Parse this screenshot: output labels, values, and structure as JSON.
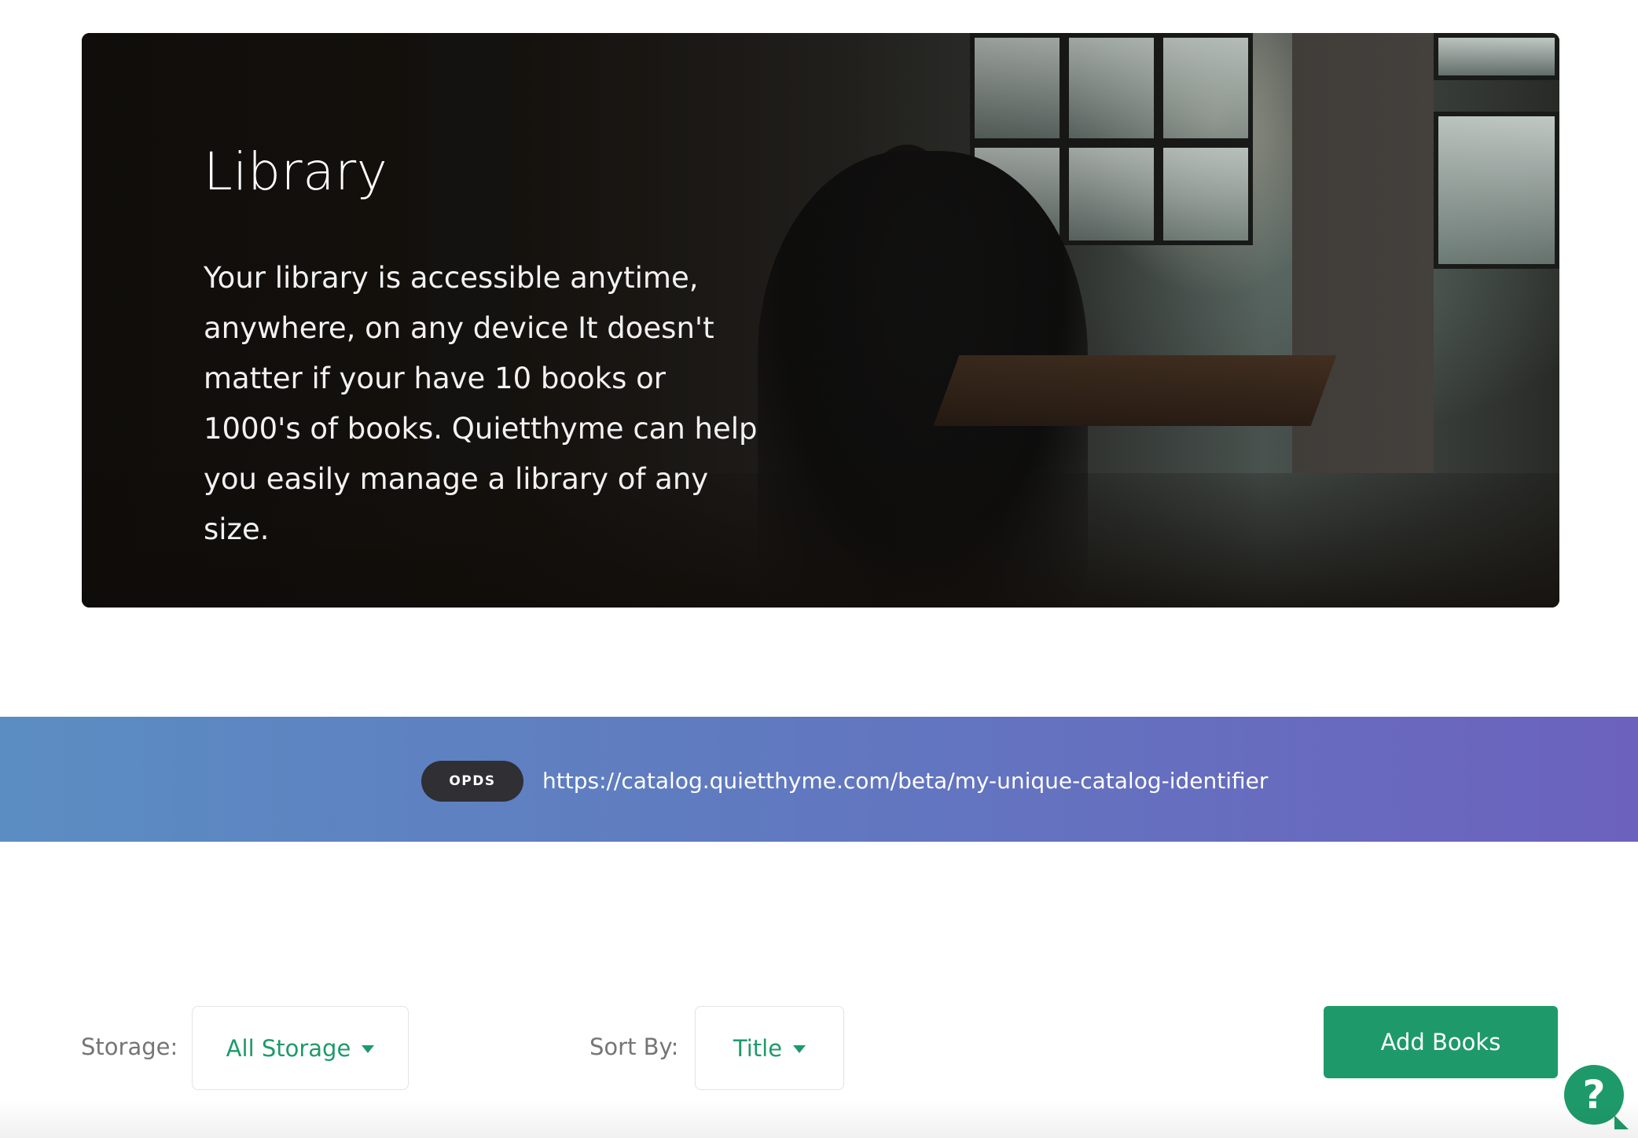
{
  "hero": {
    "title": "Library",
    "description": "Your library is accessible anytime, anywhere, on any device It doesn't matter if your have 10 books or 1000's of books. Quietthyme can help you easily manage a library of any size."
  },
  "opds": {
    "badge": "OPDS",
    "url": "https://catalog.quietthyme.com/beta/my-unique-catalog-identifier"
  },
  "controls": {
    "storage_label": "Storage:",
    "storage_value": "All Storage",
    "sort_label": "Sort By:",
    "sort_value": "Title",
    "add_books_label": "Add Books"
  },
  "help": {
    "glyph": "?",
    "icon": "help-chat-icon"
  },
  "colors": {
    "accent": "#1e9a6a",
    "banner_start": "#5b8dc2",
    "banner_end": "#6c62be",
    "badge_bg": "#2f2f34"
  }
}
